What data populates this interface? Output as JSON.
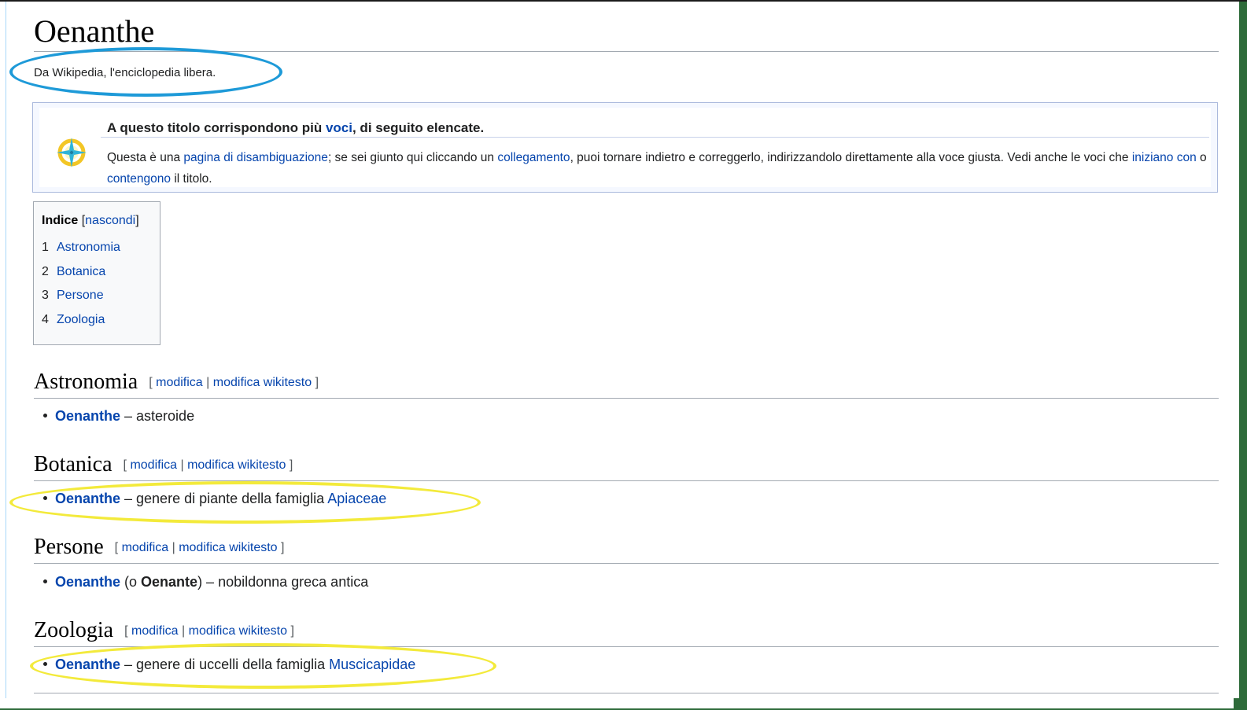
{
  "page": {
    "title": "Oenanthe",
    "subtitle": "Da Wikipedia, l'enciclopedia libera."
  },
  "hatnote": {
    "headline_pre": "A questo titolo corrispondono più ",
    "headline_link": "voci",
    "headline_post": ", di seguito elencate.",
    "text_1": "Questa è una ",
    "link_disambig": "pagina di disambiguazione",
    "text_2": "; se sei giunto qui cliccando un ",
    "link_collegamento": "collegamento",
    "text_3": ", puoi tornare indietro e correggerlo, indirizzandolo direttamente alla voce giusta. Vedi anche le voci che ",
    "link_iniziano": "iniziano con",
    "text_4": " o ",
    "link_contengono": "contengono",
    "text_5": " il titolo."
  },
  "toc": {
    "title": "Indice",
    "toggle_open": "[",
    "toggle_label": "nascondi",
    "toggle_close": "]",
    "items": [
      {
        "num": "1",
        "label": "Astronomia"
      },
      {
        "num": "2",
        "label": "Botanica"
      },
      {
        "num": "3",
        "label": "Persone"
      },
      {
        "num": "4",
        "label": "Zoologia"
      }
    ]
  },
  "edit_links": {
    "open": "[",
    "edit": "modifica",
    "sep": "|",
    "edit_source": "modifica wikitesto",
    "close": "]"
  },
  "sections": [
    {
      "heading": "Astronomia",
      "entry": {
        "link": "Oenanthe",
        "text": " – asteroide"
      }
    },
    {
      "heading": "Botanica",
      "entry": {
        "link": "Oenanthe",
        "text": " – genere di piante della famiglia ",
        "link2": "Apiaceae"
      }
    },
    {
      "heading": "Persone",
      "entry": {
        "link": "Oenanthe",
        "text_a": " (o ",
        "bold": "Oenante",
        "text_b": ") – nobildonna greca antica"
      }
    },
    {
      "heading": "Zoologia",
      "entry": {
        "link": "Oenanthe",
        "text": " – genere di uccelli della famiglia ",
        "link2": "Muscicapidae"
      }
    }
  ],
  "colors": {
    "link": "#0645ad",
    "annotation_blue": "#1e9ad8",
    "annotation_yellow": "#f3ea3b"
  },
  "icons": {
    "disambiguation": "compass-icon"
  }
}
